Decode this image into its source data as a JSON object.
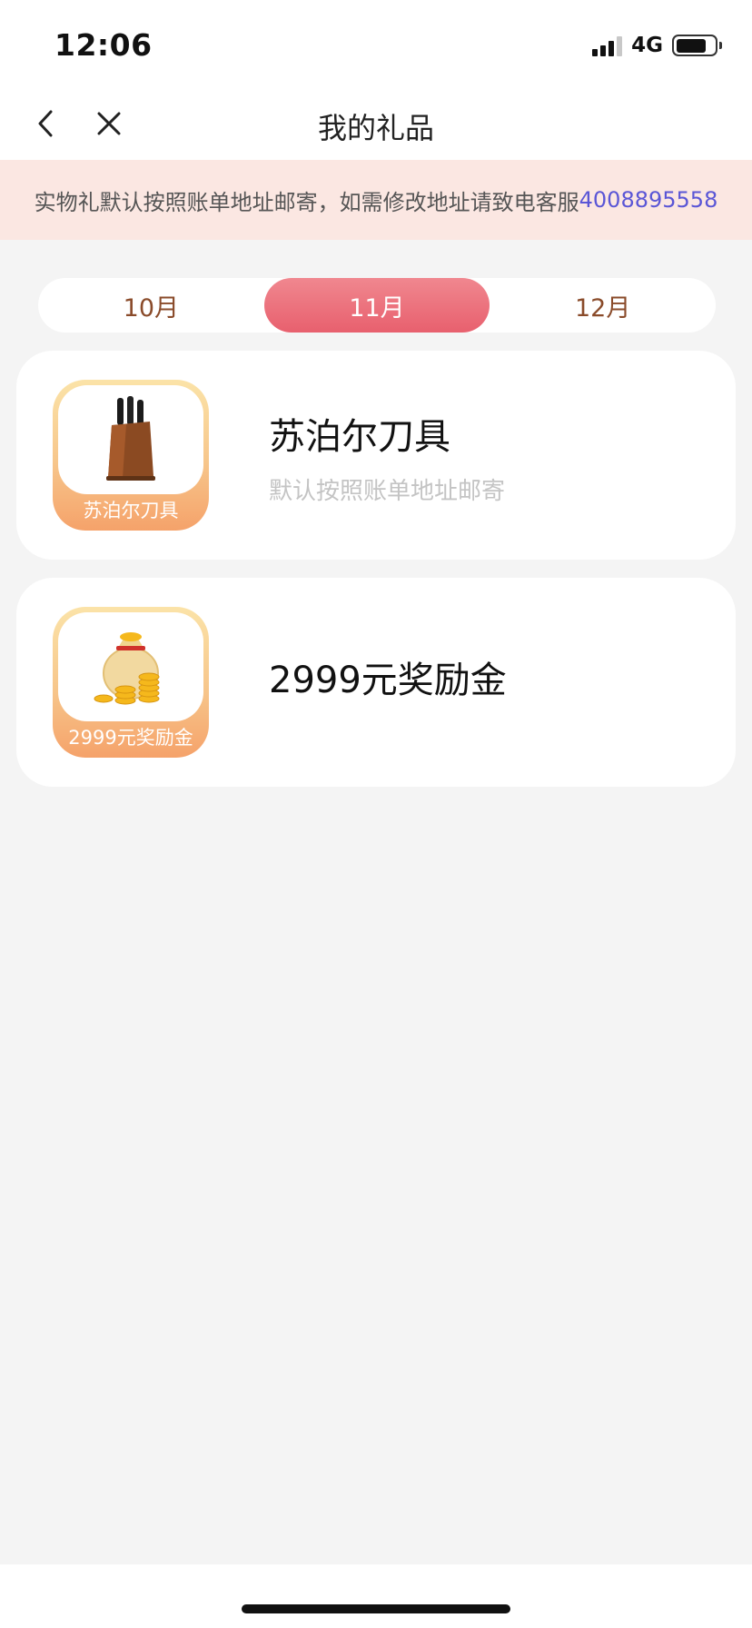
{
  "status_bar": {
    "time": "12:06",
    "network": "4G"
  },
  "nav": {
    "title": "我的礼品",
    "back_icon": "chevron-left-icon",
    "close_icon": "close-icon"
  },
  "notice": {
    "text": "实物礼默认按照账单地址邮寄，如需修改地址请致电客服",
    "phone": "4008895558"
  },
  "months": [
    {
      "label": "10月",
      "active": false
    },
    {
      "label": "11月",
      "active": true
    },
    {
      "label": "12月",
      "active": false
    }
  ],
  "gifts": [
    {
      "name": "苏泊尔刀具",
      "thumb_label": "苏泊尔刀具",
      "note": "默认按照账单地址邮寄",
      "icon": "knife-set-icon"
    },
    {
      "name": "2999元奖励金",
      "thumb_label": "2999元奖励金",
      "icon": "coin-bag-icon"
    }
  ],
  "colors": {
    "accent": "#e8606e",
    "notice_bg": "#fbe7e2",
    "phone_link": "#5a56d6",
    "month_text": "#8a4b2a"
  }
}
